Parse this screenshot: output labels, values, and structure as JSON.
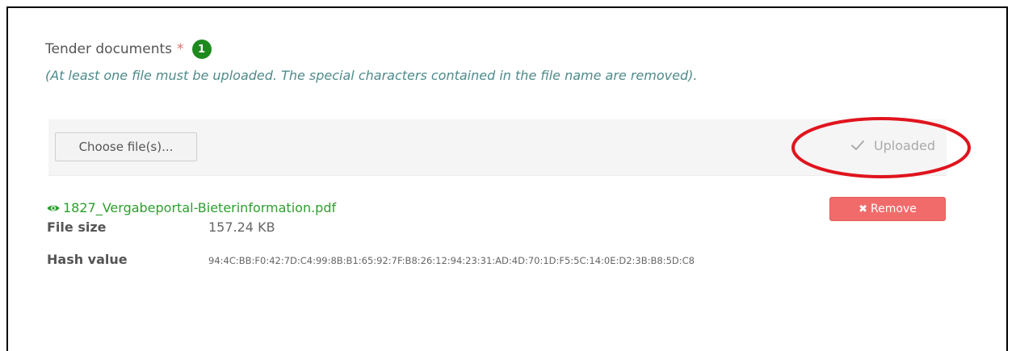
{
  "section": {
    "title": "Tender documents",
    "required_marker": "*",
    "file_count": "1",
    "hint": "(At least one file must be uploaded. The special characters contained in the file name are removed)."
  },
  "upload": {
    "choose_label": "Choose file(s)...",
    "status_label": "Uploaded"
  },
  "file": {
    "name": "1827_Vergabeportal-Bieterinformation.pdf",
    "remove_label": "Remove",
    "size_label": "File size",
    "size_value": "157.24 KB",
    "hash_label": "Hash value",
    "hash_value": "94:4C:BB:F0:42:7D:C4:99:8B:B1:65:92:7F:B8:26:12:94:23:31:AD:4D:70:1D:F5:5C:14:0E:D2:3B:B8:5D:C8"
  },
  "colors": {
    "badge": "#1e8a1e",
    "link": "#2e9e2e",
    "remove": "#f26b6b",
    "annotation": "#e0141e"
  },
  "icons": {
    "status": "check-icon",
    "file": "eye-icon",
    "remove": "x-icon"
  }
}
